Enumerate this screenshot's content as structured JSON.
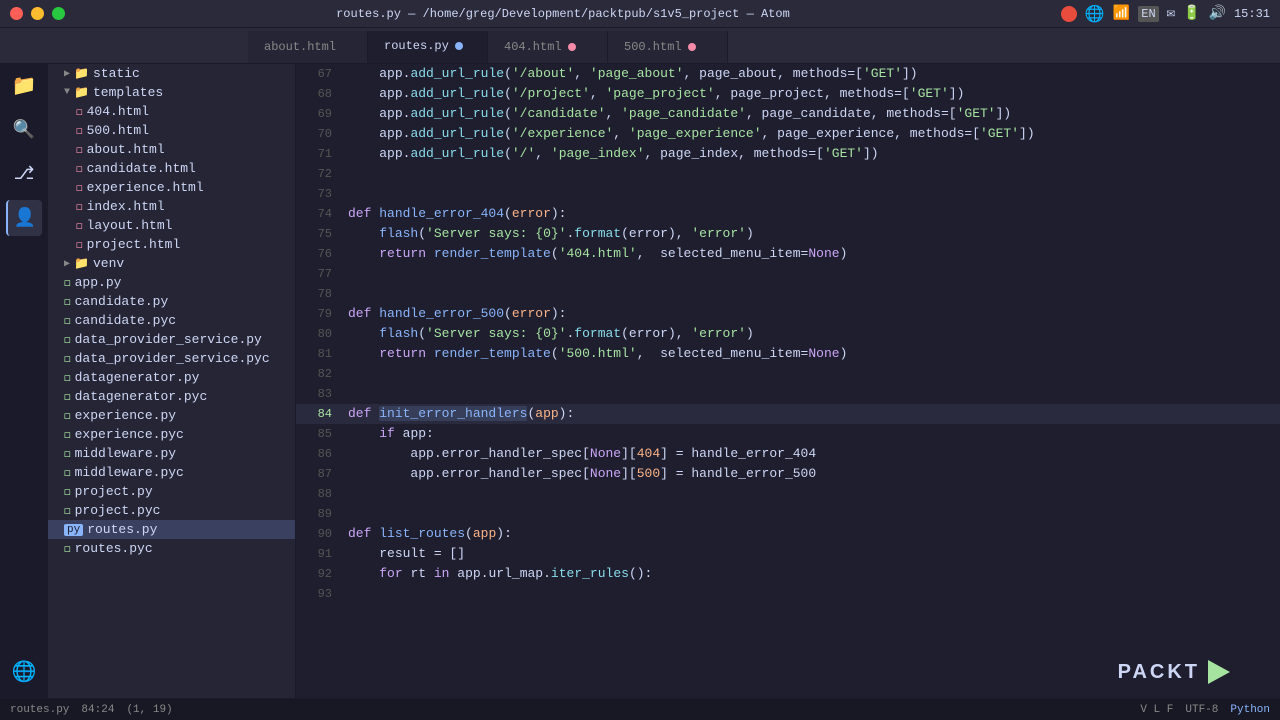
{
  "titlebar": {
    "title": "routes.py — /home/greg/Development/packtpub/s1v5_project — Atom",
    "time": "15:31"
  },
  "tabs": [
    {
      "id": "about",
      "label": "about.html",
      "active": false,
      "dot": null
    },
    {
      "id": "routes",
      "label": "routes.py",
      "active": true,
      "dot": "blue"
    },
    {
      "id": "404",
      "label": "404.html",
      "active": false,
      "dot": "unsaved"
    },
    {
      "id": "500",
      "label": "500.html",
      "active": false,
      "dot": "unsaved"
    }
  ],
  "sidebar": {
    "project_name": "s1v5_project",
    "items": [
      {
        "id": "static",
        "label": "static",
        "type": "folder",
        "depth": 1
      },
      {
        "id": "templates",
        "label": "templates",
        "type": "folder",
        "depth": 1,
        "expanded": true
      },
      {
        "id": "404html",
        "label": "404.html",
        "type": "html",
        "depth": 2
      },
      {
        "id": "500html",
        "label": "500.html",
        "type": "html",
        "depth": 2
      },
      {
        "id": "abouthtml",
        "label": "about.html",
        "type": "html",
        "depth": 2
      },
      {
        "id": "candidatehtml",
        "label": "candidate.html",
        "type": "html",
        "depth": 2
      },
      {
        "id": "experiencehtml",
        "label": "experience.html",
        "type": "html",
        "depth": 2
      },
      {
        "id": "indexhtml",
        "label": "index.html",
        "type": "html",
        "depth": 2
      },
      {
        "id": "layouthtml",
        "label": "layout.html",
        "type": "html",
        "depth": 2
      },
      {
        "id": "projecthtml",
        "label": "project.html",
        "type": "html",
        "depth": 2
      },
      {
        "id": "venv",
        "label": "venv",
        "type": "folder",
        "depth": 1
      },
      {
        "id": "apppy",
        "label": "app.py",
        "type": "py",
        "depth": 1
      },
      {
        "id": "candidatepy",
        "label": "candidate.py",
        "type": "py",
        "depth": 1
      },
      {
        "id": "candidatepyc",
        "label": "candidate.pyc",
        "type": "py",
        "depth": 1
      },
      {
        "id": "dataprovider1",
        "label": "data_provider_service.py",
        "type": "py",
        "depth": 1
      },
      {
        "id": "dataprovider2",
        "label": "data_provider_service.pyc",
        "type": "py",
        "depth": 1
      },
      {
        "id": "datageneratorpy",
        "label": "datagenerator.py",
        "type": "py",
        "depth": 1
      },
      {
        "id": "datageneratorpyc",
        "label": "datagenerator.pyc",
        "type": "py",
        "depth": 1
      },
      {
        "id": "experiencepy",
        "label": "experience.py",
        "type": "py",
        "depth": 1
      },
      {
        "id": "experiencepyc",
        "label": "experience.pyc",
        "type": "py",
        "depth": 1
      },
      {
        "id": "middlewarepy",
        "label": "middleware.py",
        "type": "py",
        "depth": 1
      },
      {
        "id": "middlewarepyc",
        "label": "middleware.pyc",
        "type": "py",
        "depth": 1
      },
      {
        "id": "projectpy",
        "label": "project.py",
        "type": "py",
        "depth": 1
      },
      {
        "id": "projectpyc",
        "label": "project.pyc",
        "type": "py",
        "depth": 1
      },
      {
        "id": "routespy",
        "label": "routes.py",
        "type": "routes",
        "depth": 1,
        "selected": true
      },
      {
        "id": "routespyc",
        "label": "routes.pyc",
        "type": "py",
        "depth": 1
      }
    ]
  },
  "editor": {
    "filename": "routes.py",
    "lines": [
      {
        "num": 67,
        "content": "    app.add_url_rule('/about', 'page_about', page_about, methods=['GET'])"
      },
      {
        "num": 68,
        "content": "    app.add_url_rule('/project', 'page_project', page_project, methods=['GET'])"
      },
      {
        "num": 69,
        "content": "    app.add_url_rule('/candidate', 'page_candidate', page_candidate, methods=['GET'])"
      },
      {
        "num": 70,
        "content": "    app.add_url_rule('/experience', 'page_experience', page_experience, methods=['GET'])"
      },
      {
        "num": 71,
        "content": "    app.add_url_rule('/', 'page_index', page_index, methods=['GET'])"
      },
      {
        "num": 72,
        "content": ""
      },
      {
        "num": 73,
        "content": ""
      },
      {
        "num": 74,
        "content": "def handle_error_404(error):"
      },
      {
        "num": 75,
        "content": "    flash('Server says: {0}'.format(error), 'error')"
      },
      {
        "num": 76,
        "content": "    return render_template('404.html',  selected_menu_item=None)"
      },
      {
        "num": 77,
        "content": ""
      },
      {
        "num": 78,
        "content": ""
      },
      {
        "num": 79,
        "content": "def handle_error_500(error):"
      },
      {
        "num": 80,
        "content": "    flash('Server says: {0}'.format(error), 'error')"
      },
      {
        "num": 81,
        "content": "    return render_template('500.html',  selected_menu_item=None)"
      },
      {
        "num": 82,
        "content": ""
      },
      {
        "num": 83,
        "content": ""
      },
      {
        "num": 84,
        "content": "def init_error_handlers(app):",
        "current": true
      },
      {
        "num": 85,
        "content": "    if app:"
      },
      {
        "num": 86,
        "content": "        app.error_handler_spec[None][404] = handle_error_404"
      },
      {
        "num": 87,
        "content": "        app.error_handler_spec[None][500] = handle_error_500"
      },
      {
        "num": 88,
        "content": ""
      },
      {
        "num": 89,
        "content": ""
      },
      {
        "num": 90,
        "content": "def list_routes(app):"
      },
      {
        "num": 91,
        "content": "    result = []"
      },
      {
        "num": 92,
        "content": "    for rt in app.url_map.iter_rules():"
      },
      {
        "num": 93,
        "content": ""
      }
    ]
  },
  "statusbar": {
    "file": "routes.py",
    "position": "84:24",
    "rowcol": "(1, 19)",
    "encoding": "UTF-8",
    "language": "Python"
  }
}
